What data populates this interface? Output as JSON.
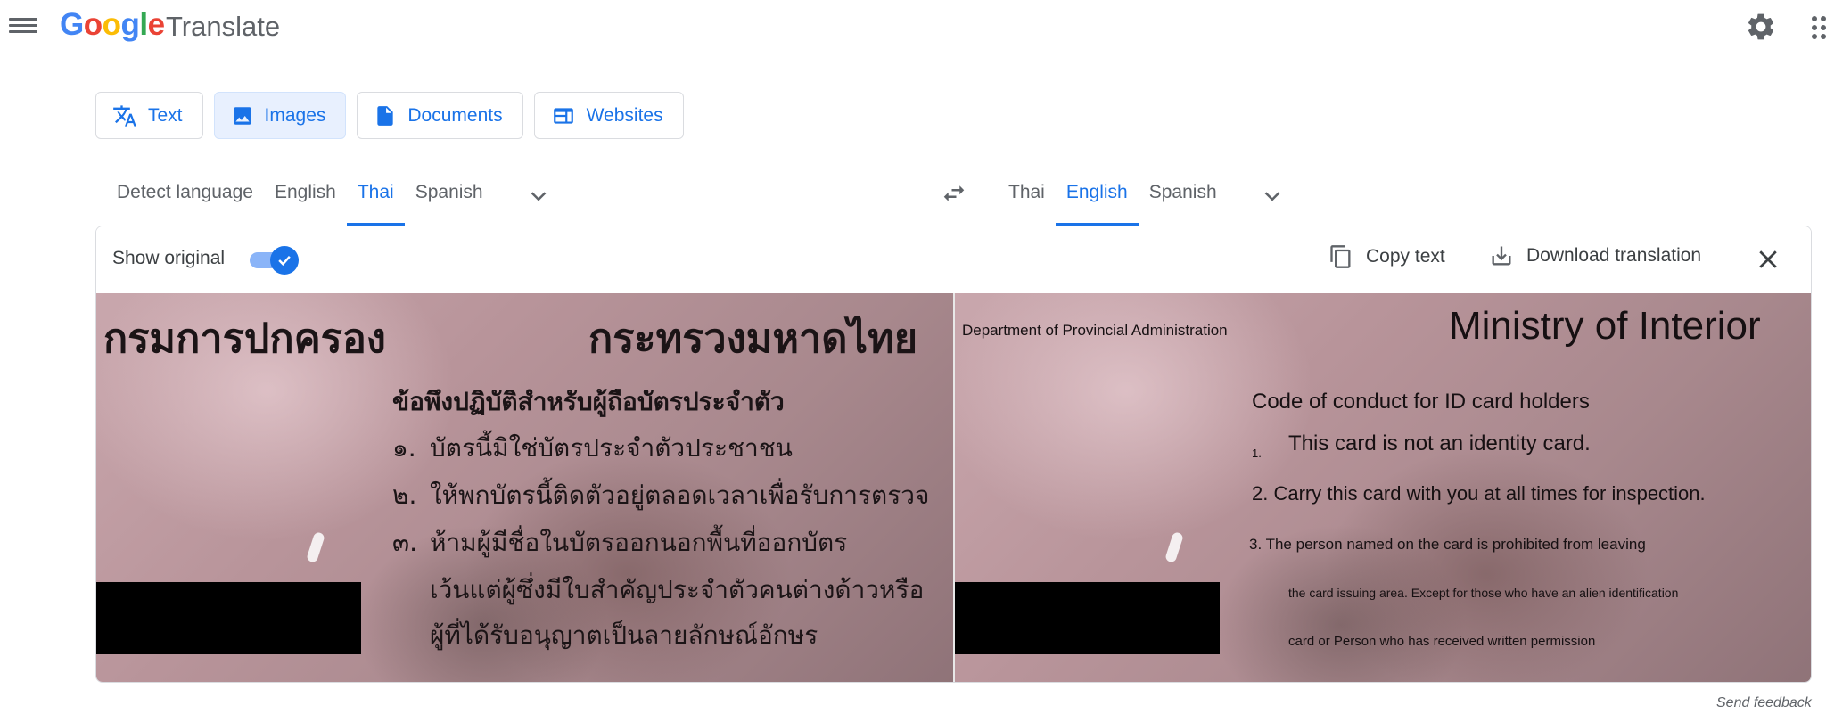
{
  "header": {
    "logo_text": {
      "G": "G",
      "o1": "o",
      "o2": "o",
      "g": "g",
      "l": "l",
      "e": "e"
    },
    "product": "Translate",
    "icons": {
      "menu": "hamburger-menu-icon",
      "settings": "gear-icon",
      "apps": "apps-grid-icon"
    }
  },
  "modes": [
    {
      "label": "Text",
      "icon": "translate-icon"
    },
    {
      "label": "Images",
      "icon": "image-icon",
      "active": true
    },
    {
      "label": "Documents",
      "icon": "document-icon"
    },
    {
      "label": "Websites",
      "icon": "website-icon"
    }
  ],
  "source_langs": [
    "Detect language",
    "English",
    "Thai",
    "Spanish"
  ],
  "source_active": "Thai",
  "target_langs": [
    "Thai",
    "English",
    "Spanish"
  ],
  "target_active": "English",
  "panel": {
    "show_original": "Show original",
    "show_original_on": true,
    "copy_text": "Copy text",
    "download": "Download translation"
  },
  "original": {
    "line1_left": "กรมการปกครอง",
    "line1_right": "กระทรวงมหาดไทย",
    "heading": "ข้อพึงปฏิบัติสำหรับผู้ถือบัตรประจำตัว",
    "item1_num": "๑.",
    "item1": "บัตรนี้มิใช่บัตรประจำตัวประชาชน",
    "item2_num": "๒.",
    "item2": "ให้พกบัตรนี้ติดตัวอยู่ตลอดเวลาเพื่อรับการตรวจ",
    "item3_num": "๓.",
    "item3": "ห้ามผู้มีชื่อในบัตรออกนอกพื้นที่ออกบัตร",
    "item3_cont1": "เว้นแต่ผู้ซึ่งมีใบสำคัญประจำตัวคนต่างด้าวหรือ",
    "item3_cont2": "ผู้ที่ได้รับอนุญาตเป็นลายลักษณ์อักษร"
  },
  "translated": {
    "dept": "Department of Provincial Administration",
    "ministry": "Ministry of Interior",
    "heading": "Code of conduct for ID card holders",
    "item1_num": "1.",
    "item1": "This card is not an identity card.",
    "item2": "2. Carry this card with you at all times for inspection.",
    "item3": "3. The person named on the card is prohibited from leaving",
    "item3_cont1": "the card issuing area. Except for those who have an alien identification",
    "item3_cont2": "card or Person who has received written permission"
  },
  "footer": {
    "send_feedback": "Send feedback"
  }
}
